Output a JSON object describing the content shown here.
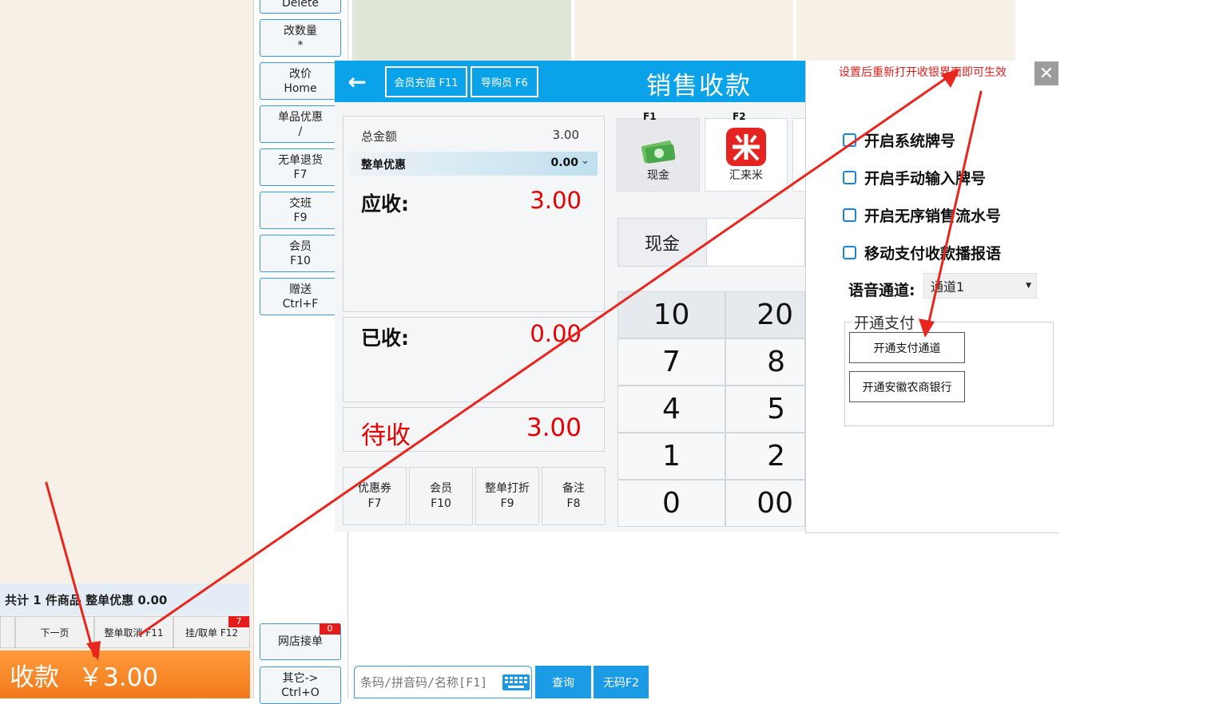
{
  "left_panel": {
    "summary": "共计 1 件商品 整单优惠 0.00",
    "bottom_buttons": [
      {
        "label": ""
      },
      {
        "label": "下一页"
      },
      {
        "label": "整单取消 F11"
      },
      {
        "label": "挂/取单 F12",
        "badge": "7"
      }
    ],
    "pay_label": "收款",
    "pay_amount": "￥3.00"
  },
  "function_buttons": [
    {
      "line1": "Delete",
      "line2": ""
    },
    {
      "line1": "改数量",
      "line2": "*"
    },
    {
      "line1": "改价",
      "line2": "Home"
    },
    {
      "line1": "单品优惠",
      "line2": "/"
    },
    {
      "line1": "无单退货",
      "line2": "F7"
    },
    {
      "line1": "交班",
      "line2": "F9"
    },
    {
      "line1": "会员",
      "line2": "F10"
    },
    {
      "line1": "赠送",
      "line2": "Ctrl+F"
    },
    {
      "line1": "网店接单",
      "line2": "",
      "badge": "0"
    },
    {
      "line1": "其它->",
      "line2": "Ctrl+O"
    }
  ],
  "dialog": {
    "title": "销售收款",
    "header_buttons": [
      "会员充值 F11",
      "导购员 F6"
    ],
    "total_label": "总金额",
    "total_value": "3.00",
    "discount_label": "整单优惠",
    "discount_value": "0.00",
    "receivable_label": "应收:",
    "receivable_value": "3.00",
    "received_label": "已收:",
    "received_value": "0.00",
    "pending_label": "待收",
    "pending_value": "3.00",
    "pay_methods": [
      {
        "key": "F1",
        "label": "现金"
      },
      {
        "key": "F2",
        "label": "汇来米"
      }
    ],
    "payment_field_label": "现金",
    "numpad": [
      "10",
      "20",
      "7",
      "8",
      "4",
      "5",
      "1",
      "2",
      "0",
      "00"
    ],
    "action_buttons": [
      {
        "line1": "优惠券",
        "line2": "F7"
      },
      {
        "line1": "会员",
        "line2": "F10"
      },
      {
        "line1": "整单打折",
        "line2": "F9"
      },
      {
        "line1": "备注",
        "line2": "F8"
      }
    ]
  },
  "settings": {
    "notice": "设置后重新打开收银界面即可生效",
    "options": [
      "开启系统牌号",
      "开启手动输入牌号",
      "开启无序销售流水号",
      "移动支付收款播报语"
    ],
    "voice_channel_label": "语音通道:",
    "voice_channel_value": "通道1",
    "payment_group_label": "开通支付",
    "payment_buttons": [
      "开通支付通道",
      "开通安徽农商银行"
    ]
  },
  "search": {
    "placeholder": "条码/拼音码/名称[F1]",
    "query_button": "查询",
    "no_code_button": "无码F2"
  },
  "colors": {
    "header_blue": "#0aa3ea",
    "amount_red": "#e60000",
    "pay_orange": "#f5841f",
    "annotation_red": "#e8261e"
  }
}
